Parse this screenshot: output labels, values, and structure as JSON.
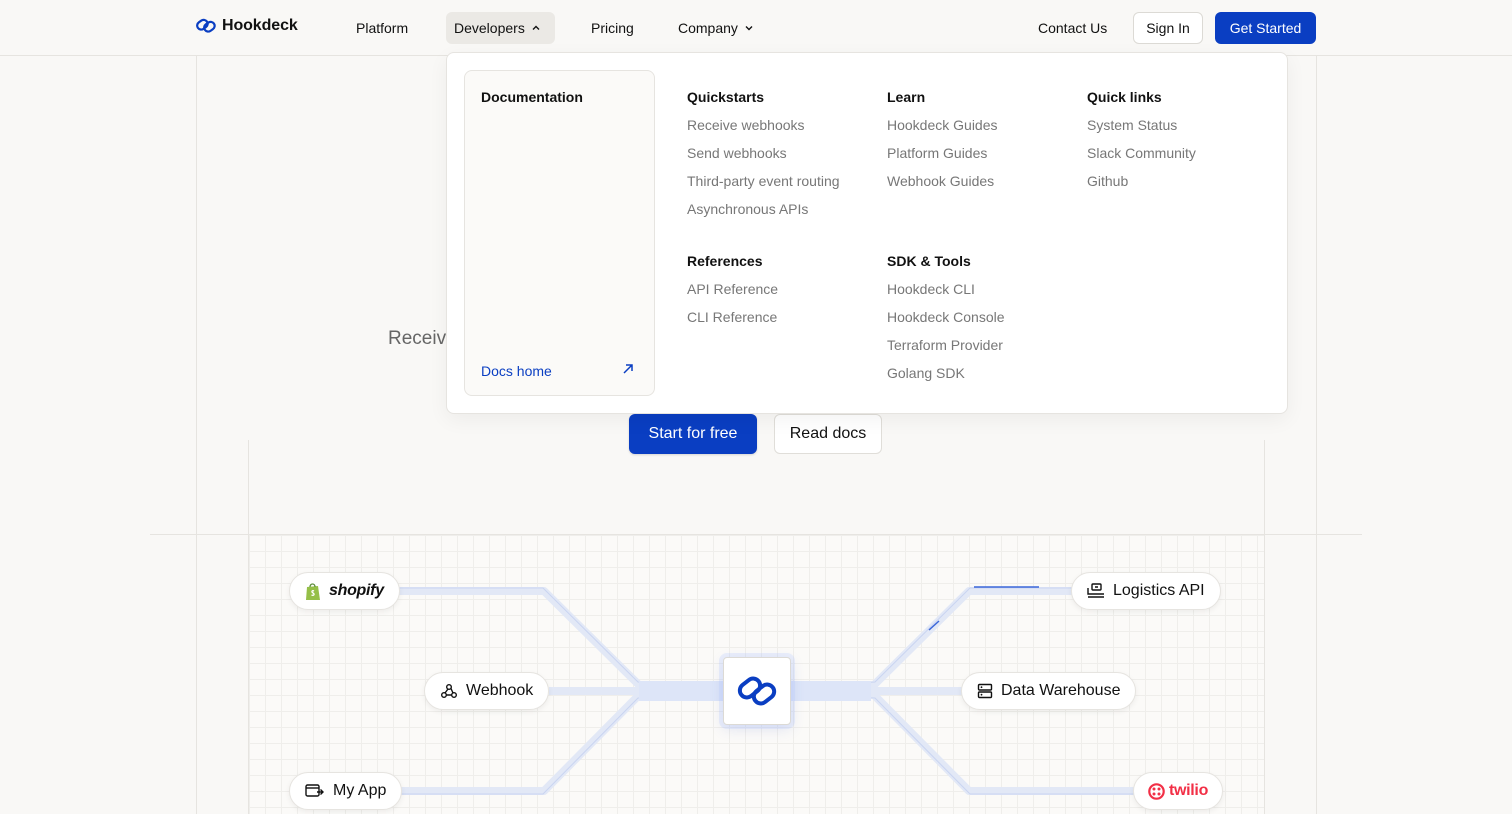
{
  "header": {
    "brand": "Hookdeck",
    "nav": {
      "platform": "Platform",
      "developers": "Developers",
      "pricing": "Pricing",
      "company": "Company"
    },
    "contact": "Contact Us",
    "sign_in": "Sign In",
    "get_started": "Get Started"
  },
  "dropdown": {
    "doc_card": {
      "title": "Documentation",
      "link": "Docs home"
    },
    "quickstarts": {
      "title": "Quickstarts",
      "links": [
        "Receive webhooks",
        "Send webhooks",
        "Third-party event routing",
        "Asynchronous APIs"
      ]
    },
    "learn": {
      "title": "Learn",
      "links": [
        "Hookdeck Guides",
        "Platform Guides",
        "Webhook Guides"
      ]
    },
    "quick_links": {
      "title": "Quick links",
      "links": [
        "System Status",
        "Slack Community",
        "Github"
      ]
    },
    "references": {
      "title": "References",
      "links": [
        "API Reference",
        "CLI Reference"
      ]
    },
    "sdk_tools": {
      "title": "SDK & Tools",
      "links": [
        "Hookdeck CLI",
        "Hookdeck Console",
        "Terraform Provider",
        "Golang SDK"
      ]
    }
  },
  "hero": {
    "fragment": "Receiv",
    "cta_primary": "Start for free",
    "cta_secondary": "Read docs"
  },
  "diagram": {
    "sources": {
      "shopify": "shopify",
      "webhook": "Webhook",
      "my_app": "My App"
    },
    "destinations": {
      "logistics": "Logistics API",
      "warehouse": "Data Warehouse",
      "twilio": "twilio"
    }
  },
  "colors": {
    "brand_blue": "#0a3ec2",
    "shopify_green": "#95bf47",
    "twilio_red": "#f22f46"
  }
}
